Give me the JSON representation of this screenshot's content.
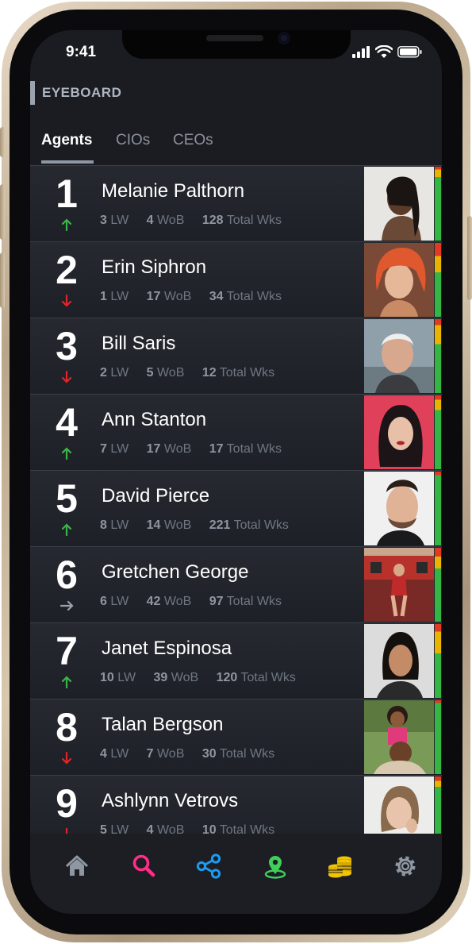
{
  "status": {
    "time": "9:41"
  },
  "brand": "EYEBOARD",
  "tabs": [
    {
      "label": "Agents",
      "active": true
    },
    {
      "label": "CIOs",
      "active": false
    },
    {
      "label": "CEOs",
      "active": false
    }
  ],
  "stat_labels": {
    "lw": "LW",
    "wob": "WoB",
    "total": "Total Wks"
  },
  "agents": [
    {
      "rank": "1",
      "trend": "up",
      "name": "Melanie Palthorn",
      "lw": "3",
      "wob": "4",
      "total": "128"
    },
    {
      "rank": "2",
      "trend": "down",
      "name": "Erin Siphron",
      "lw": "1",
      "wob": "17",
      "total": "34"
    },
    {
      "rank": "3",
      "trend": "down",
      "name": "Bill Saris",
      "lw": "2",
      "wob": "5",
      "total": "12"
    },
    {
      "rank": "4",
      "trend": "up",
      "name": "Ann Stanton",
      "lw": "7",
      "wob": "17",
      "total": "17"
    },
    {
      "rank": "5",
      "trend": "up",
      "name": "David Pierce",
      "lw": "8",
      "wob": "14",
      "total": "221"
    },
    {
      "rank": "6",
      "trend": "same",
      "name": "Gretchen George",
      "lw": "6",
      "wob": "42",
      "total": "97"
    },
    {
      "rank": "7",
      "trend": "up",
      "name": "Janet Espinosa",
      "lw": "10",
      "wob": "39",
      "total": "120"
    },
    {
      "rank": "8",
      "trend": "down",
      "name": "Talan Bergson",
      "lw": "4",
      "wob": "7",
      "total": "30"
    },
    {
      "rank": "9",
      "trend": "down",
      "name": "Ashlynn Vetrovs",
      "lw": "5",
      "wob": "4",
      "total": "10"
    }
  ],
  "colors": {
    "up": "#3bb54a",
    "down": "#e0252b",
    "same": "#9aa1aa",
    "meter_green": "#35b544",
    "meter_yellow": "#e8b400",
    "meter_red": "#e23a22"
  },
  "nav": [
    {
      "icon": "home-icon",
      "color": "#8e97a2"
    },
    {
      "icon": "search-icon",
      "color": "#ff2d87"
    },
    {
      "icon": "share-icon",
      "color": "#1e9bf0"
    },
    {
      "icon": "location-icon",
      "color": "#3fd05a"
    },
    {
      "icon": "coins-icon",
      "color": "#f2c500"
    },
    {
      "icon": "settings-icon",
      "color": "#8e97a2"
    }
  ]
}
